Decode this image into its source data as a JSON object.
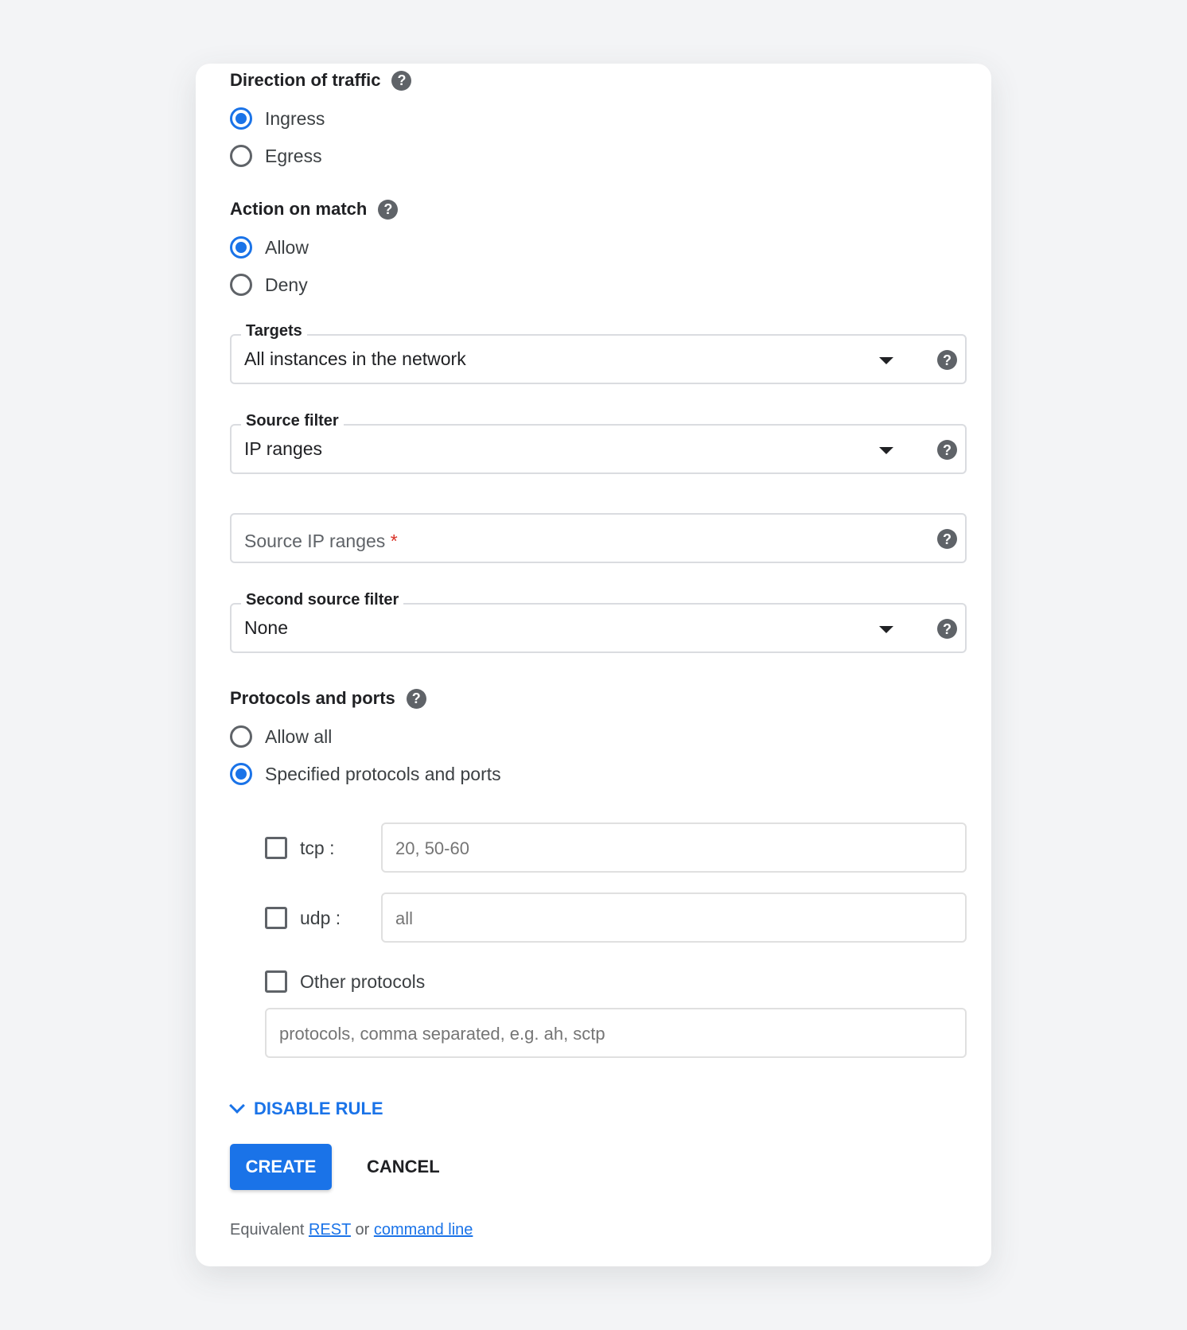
{
  "direction": {
    "title": "Direction of traffic",
    "options": [
      {
        "label": "Ingress",
        "selected": true
      },
      {
        "label": "Egress",
        "selected": false
      }
    ]
  },
  "action": {
    "title": "Action on match",
    "options": [
      {
        "label": "Allow",
        "selected": true
      },
      {
        "label": "Deny",
        "selected": false
      }
    ]
  },
  "targets": {
    "label": "Targets",
    "value": "All instances in the network"
  },
  "source_filter": {
    "label": "Source filter",
    "value": "IP ranges"
  },
  "source_ip": {
    "placeholder": "Source IP ranges",
    "required_mark": "*"
  },
  "second_source_filter": {
    "label": "Second source filter",
    "value": "None"
  },
  "protocols": {
    "title": "Protocols and ports",
    "options": [
      {
        "label": "Allow all",
        "selected": false
      },
      {
        "label": "Specified protocols and ports",
        "selected": true
      }
    ],
    "tcp": {
      "label": "tcp :",
      "checked": false,
      "placeholder": "20, 50-60"
    },
    "udp": {
      "label": "udp :",
      "checked": false,
      "placeholder": "all"
    },
    "other": {
      "label": "Other protocols",
      "checked": false,
      "placeholder": "protocols, comma separated, e.g. ah, sctp"
    }
  },
  "disable_rule": "DISABLE RULE",
  "buttons": {
    "create": "CREATE",
    "cancel": "CANCEL"
  },
  "footer": {
    "prefix": "Equivalent",
    "rest": "REST",
    "or": "or",
    "command_line": "command line"
  },
  "colors": {
    "accent": "#1a73e8",
    "required": "#d93025"
  }
}
